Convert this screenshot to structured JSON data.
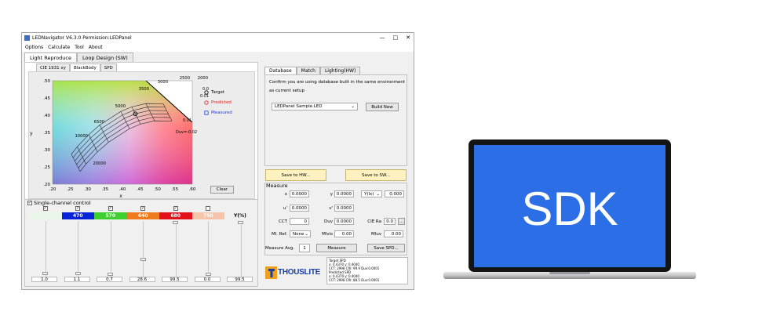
{
  "window": {
    "title": "LEDNavigator V6.3.0 Permission:LEDPanel",
    "controls": [
      "—",
      "□",
      "✕"
    ]
  },
  "menu": [
    "Options",
    "Calculate",
    "Tool",
    "About"
  ],
  "main_tabs": [
    "Light Reproduce",
    "Loop Design (SW)"
  ],
  "chart_tabs": [
    "CIE 1931 xy",
    "BlackBody",
    "SPD"
  ],
  "chart_data": {
    "type": "scatter",
    "xlabel": "x",
    "ylabel": "y",
    "x_ticks": [
      ".20",
      ".25",
      ".30",
      ".35",
      ".40",
      ".45",
      ".50",
      ".55",
      ".60"
    ],
    "y_ticks": [
      ".50",
      ".45",
      ".40",
      ".35",
      ".30",
      ".25",
      ".20"
    ],
    "xlim": [
      0.2,
      0.6
    ],
    "ylim": [
      0.2,
      0.5
    ],
    "cct_labels": [
      "2000",
      "2500",
      "3000",
      "3500",
      "5000",
      "6500",
      "10000",
      "20000"
    ],
    "duv_labels": [
      "0.02",
      "0.01",
      "0.01",
      "Duv=-0.02"
    ],
    "target_point": {
      "x": 0.437,
      "y": 0.404
    },
    "legend": [
      "Target",
      "Predicted",
      "Measured"
    ],
    "legend_colors": [
      "#000000",
      "#e02020",
      "#2040e0"
    ]
  },
  "clear_label": "Clear",
  "single_channel": {
    "label": "Single-channel control",
    "y_label": "Y(%)",
    "channels": [
      {
        "label": "",
        "color": "#e8f7ea",
        "checked": true,
        "value": "1.0",
        "level": 0.01
      },
      {
        "label": "470",
        "color": "#0a22d8",
        "checked": true,
        "value": "1.1",
        "level": 0.011
      },
      {
        "label": "570",
        "color": "#3ccf2e",
        "checked": true,
        "value": "0.7",
        "level": 0.007
      },
      {
        "label": "640",
        "color": "#f07a1e",
        "checked": true,
        "value": "28.6",
        "level": 0.286
      },
      {
        "label": "680",
        "color": "#e3111b",
        "checked": true,
        "value": "99.5",
        "level": 0.995
      },
      {
        "label": "750",
        "color": "#f6c4a8",
        "checked": false,
        "value": "0.0",
        "level": 0.0
      },
      {
        "label": "",
        "color": "",
        "checked": false,
        "value": "99.5",
        "level": 0.995
      }
    ]
  },
  "right_tabs": [
    "Database",
    "Match",
    "Lighting(HW)"
  ],
  "database": {
    "message_line1": "Confirm you are using database built in the same environment",
    "message_line2": "as current setup",
    "selected_db": "LEDPanel Sample.LED",
    "build_new": "Build New"
  },
  "save_hw": "Save to HW...",
  "save_sw": "Save to SW...",
  "measure": {
    "title": "Measure",
    "x_label": "x",
    "x_value": "0.0000",
    "y_label": "y",
    "y_value": "0.0000",
    "yunit_select": "Y(lx)",
    "yunit_value": "0.000",
    "u_label": "u'",
    "u_value": "0.0000",
    "v_label": "v'",
    "v_value": "0.0000",
    "cct_label": "CCT",
    "cct_value": "0",
    "duv_label": "Duv",
    "duv_value": "0.0000",
    "cieRa_label": "CIE Ra",
    "cieRa_value": "0.0",
    "more": "...",
    "mlref_label": "Ml. Ref.",
    "mlref_value": "None",
    "mlvis_label": "Mlvis",
    "mlvis_value": "0.00",
    "mluv_label": "Mluv",
    "mluv_value": "0.00",
    "avg_label": "Measure Avg.",
    "avg_value": "1",
    "measure_btn": "Measure",
    "save_spd": "Save SPD..."
  },
  "logo_text": "THOUSLITE",
  "info_panel": {
    "lines": [
      "Target SPD",
      "x: 0.4370      y: 0.4040",
      "CCT: 2998      CRI: 99.9      Duv:0.0001",
      "Predicted SPD",
      "x: 0.4370      y: 0.4040",
      "CCT: 2998      CRI: 88.5      Duv:0.0001"
    ]
  },
  "sdk_label": "SDK",
  "colors": {
    "screen_blue": "#2c6ee6",
    "laptop_bezel": "#111111",
    "laptop_base": "#c9c9cb"
  }
}
